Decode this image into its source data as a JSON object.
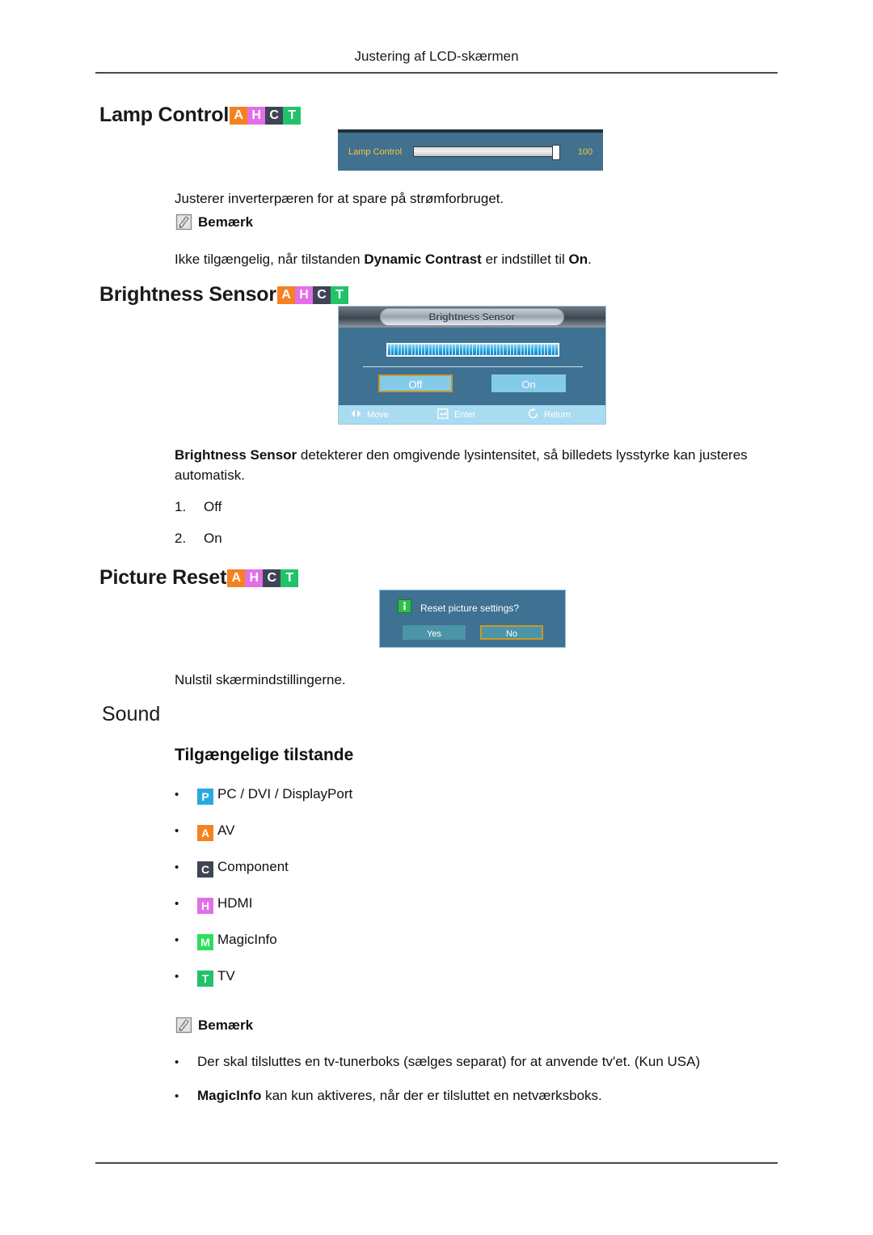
{
  "header": {
    "title": "Justering af LCD-skærmen"
  },
  "sections": {
    "lamp_control": {
      "heading": "Lamp Control",
      "badges": [
        "A",
        "H",
        "C",
        "T"
      ],
      "osd": {
        "label": "Lamp Control",
        "value": "100"
      },
      "description": "Justerer inverterpæren for at spare på strømforbruget.",
      "note_label": "Bemærk",
      "note_text_1": "Ikke tilgængelig, når tilstanden ",
      "note_bold": "Dynamic Contrast",
      "note_text_2": " er indstillet til ",
      "note_bold_2": "On",
      "note_text_3": "."
    },
    "brightness_sensor": {
      "heading": "Brightness Sensor",
      "badges": [
        "A",
        "H",
        "C",
        "T"
      ],
      "osd": {
        "title": "Brightness Sensor",
        "button_off": "Off",
        "button_on": "On",
        "foot_move": "Move",
        "foot_enter": "Enter",
        "foot_return": "Return"
      },
      "description_bold": "Brightness Sensor",
      "description_rest": " detekterer den omgivende lysintensitet, så billedets lysstyrke kan justeres automatisk.",
      "options": [
        {
          "num": "1.",
          "label": "Off"
        },
        {
          "num": "2.",
          "label": "On"
        }
      ]
    },
    "picture_reset": {
      "heading": "Picture Reset",
      "badges": [
        "A",
        "H",
        "C",
        "T"
      ],
      "osd": {
        "message": "Reset picture settings?",
        "button_yes": "Yes",
        "button_no": "No"
      },
      "description": "Nulstil skærmindstillingerne."
    },
    "sound": {
      "heading": "Sound",
      "sub_heading": "Tilgængelige tilstande",
      "modes": [
        {
          "badge": "P",
          "label": "PC / DVI / DisplayPort"
        },
        {
          "badge": "A",
          "label": "AV"
        },
        {
          "badge": "C",
          "label": "Component"
        },
        {
          "badge": "H",
          "label": "HDMI"
        },
        {
          "badge": "M",
          "label": "MagicInfo"
        },
        {
          "badge": "T",
          "label": "TV"
        }
      ],
      "note_label": "Bemærk",
      "notes": [
        {
          "bold": "",
          "text": "Der skal tilsluttes en tv-tunerboks (sælges separat) for at anvende tv'et. (Kun USA)"
        },
        {
          "bold": "MagicInfo",
          "text": " kan kun aktiveres, når der er tilsluttet en netværksboks."
        }
      ]
    }
  },
  "colors": {
    "badge_a": "#f58220",
    "badge_h": "#e36fe8",
    "badge_c": "#3f4556",
    "badge_t": "#22c26b",
    "badge_p": "#2aa9e0",
    "badge_m": "#2ae05a",
    "osd_panel": "#3f7193",
    "osd_lamp_panel": "#41718f",
    "osd_label": "#f5c542",
    "selection_border": "#c79a2a"
  }
}
